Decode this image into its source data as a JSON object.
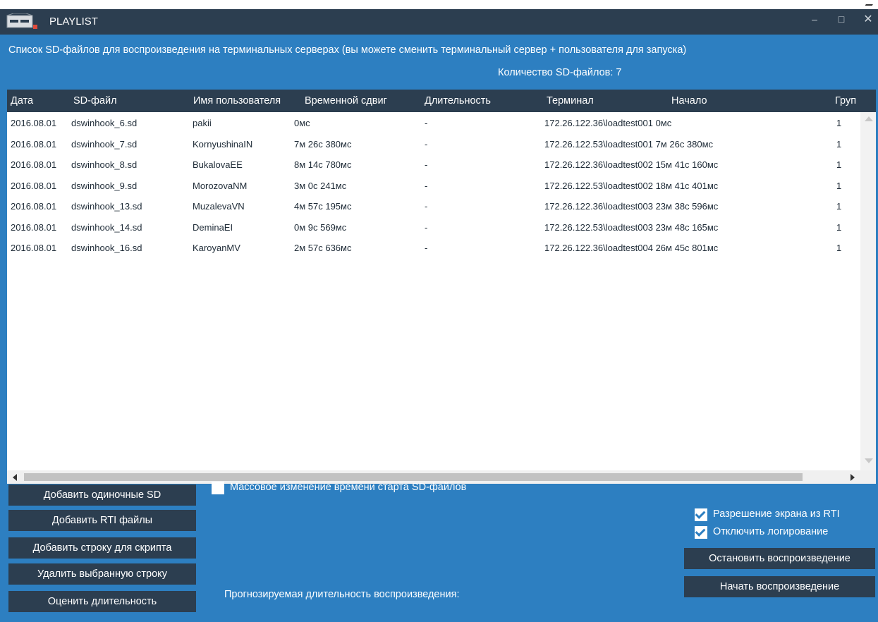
{
  "window": {
    "title": "PLAYLIST"
  },
  "caption": "Список SD-файлов для воспроизведения на терминальных серверах (вы можете сменить терминальный сервер + пользователя для запуска)",
  "count_label": "Количество SD-файлов: 7",
  "table": {
    "headers": [
      "Дата",
      "SD-файл",
      "Имя пользователя",
      "Временной сдвиг",
      "Длительность",
      "Терминал",
      "Начало",
      "Груп"
    ],
    "rows": [
      [
        "2016.08.01",
        "dswinhook_6.sd",
        "pakii",
        "0мс",
        "-",
        "172.26.122.36\\loadtest001 0мс",
        "1"
      ],
      [
        "2016.08.01",
        "dswinhook_7.sd",
        "KornyushinaIN",
        "7м 26с 380мс",
        "-",
        "172.26.122.53\\loadtest001 7м 26с 380мс",
        "1"
      ],
      [
        "2016.08.01",
        "dswinhook_8.sd",
        "BukalovaEE",
        "8м 14с 780мс",
        "-",
        "172.26.122.36\\loadtest002 15м 41с 160мс",
        "1"
      ],
      [
        "2016.08.01",
        "dswinhook_9.sd",
        "MorozovaNM",
        "3м 0с 241мс",
        "-",
        "172.26.122.53\\loadtest002 18м 41с 401мс",
        "1"
      ],
      [
        "2016.08.01",
        "dswinhook_13.sd",
        "MuzalevaVN",
        "4м 57с 195мс",
        "-",
        "172.26.122.36\\loadtest003 23м 38с 596мс",
        "1"
      ],
      [
        "2016.08.01",
        "dswinhook_14.sd",
        "DeminaEI",
        "0м 9с 569мс",
        "-",
        "172.26.122.53\\loadtest003 23м 48с 165мс",
        "1"
      ],
      [
        "2016.08.01",
        "dswinhook_16.sd",
        "KaroyanMV",
        "2м 57с 636мс",
        "-",
        "172.26.122.36\\loadtest004 26м 45с 801мс",
        "1"
      ]
    ]
  },
  "buttons": {
    "add_single_sd": "Добавить одиночные SD",
    "add_rti": "Добавить RTI файлы",
    "add_script_row": "Добавить строку для скрипта",
    "delete_row": "Удалить выбранную строку",
    "estimate": "Оценить длительность",
    "stop": "Остановить воспроизведение",
    "start": "Начать воспроизведение"
  },
  "checkboxes": {
    "mass_change": {
      "label": "Массовое изменение времени старта SD-файлов",
      "checked": false
    },
    "screen_res": {
      "label": "Разрешение экрана из RTI",
      "checked": true
    },
    "disable_logging": {
      "label": "Отключить логирование",
      "checked": true
    }
  },
  "forecast_label": "Прогнозируемая длительность воспроизведения:",
  "colors": {
    "title_bar": "#2c3e50",
    "background": "#2d7fc1",
    "header": "#2c3e50",
    "button": "#2c3e50"
  }
}
